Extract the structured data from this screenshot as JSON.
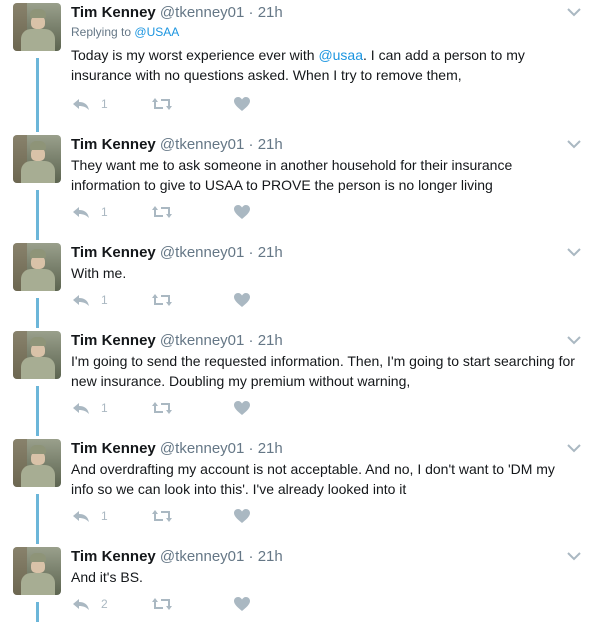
{
  "colors": {
    "link": "#1b95e0",
    "thread": "#6cb6d9",
    "muted": "#657786",
    "icon": "#aab8c2"
  },
  "icons": {
    "reply": "reply-icon",
    "retweet": "retweet-icon",
    "like": "heart-icon",
    "menu": "chevron-down-icon"
  },
  "tweets": [
    {
      "name": "Tim Kenney",
      "handle": "@tkenney01",
      "sep": "·",
      "time": "21h",
      "reply_prefix": "Replying to",
      "reply_user": "@USAA",
      "text_before": "Today is my worst experience ever with ",
      "mention": "@usaa",
      "text_after": ".  I can add a person to my insurance with no questions asked.  When I try to remove them,",
      "reply_count": "1"
    },
    {
      "name": "Tim Kenney",
      "handle": "@tkenney01",
      "sep": "·",
      "time": "21h",
      "text": "They want me to ask someone in another household for their insurance information to give to USAA to PROVE the person is no longer living",
      "reply_count": "1"
    },
    {
      "name": "Tim Kenney",
      "handle": "@tkenney01",
      "sep": "·",
      "time": "21h",
      "text": "With me.",
      "reply_count": "1"
    },
    {
      "name": "Tim Kenney",
      "handle": "@tkenney01",
      "sep": "·",
      "time": "21h",
      "text": "I'm going to send the requested information.  Then, I'm going to start searching for new insurance.  Doubling my premium without warning,",
      "reply_count": "1"
    },
    {
      "name": "Tim Kenney",
      "handle": "@tkenney01",
      "sep": "·",
      "time": "21h",
      "text": "And overdrafting my account is not acceptable.  And no, I don't want to 'DM my info so we can look into this'.  I've already looked into it",
      "reply_count": "1"
    },
    {
      "name": "Tim Kenney",
      "handle": "@tkenney01",
      "sep": "·",
      "time": "21h",
      "text": "And it's BS.",
      "reply_count": "2"
    }
  ]
}
